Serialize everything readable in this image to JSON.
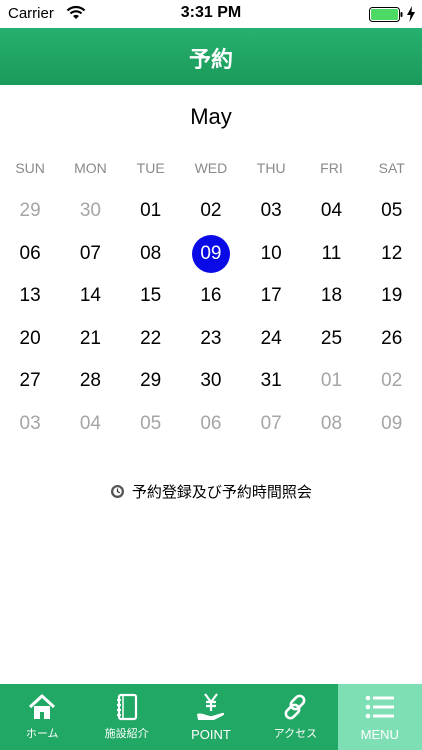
{
  "status_bar": {
    "carrier": "Carrier",
    "time": "3:31 PM"
  },
  "nav": {
    "title": "予約"
  },
  "calendar": {
    "month": "May",
    "weekdays": [
      "SUN",
      "MON",
      "TUE",
      "WED",
      "THU",
      "FRI",
      "SAT"
    ],
    "selected_day": "09",
    "days": [
      {
        "label": "29",
        "muted": true
      },
      {
        "label": "30",
        "muted": true
      },
      {
        "label": "01"
      },
      {
        "label": "02"
      },
      {
        "label": "03"
      },
      {
        "label": "04"
      },
      {
        "label": "05"
      },
      {
        "label": "06"
      },
      {
        "label": "07"
      },
      {
        "label": "08"
      },
      {
        "label": "09",
        "selected": true
      },
      {
        "label": "10"
      },
      {
        "label": "11"
      },
      {
        "label": "12"
      },
      {
        "label": "13"
      },
      {
        "label": "14"
      },
      {
        "label": "15"
      },
      {
        "label": "16"
      },
      {
        "label": "17"
      },
      {
        "label": "18"
      },
      {
        "label": "19"
      },
      {
        "label": "20"
      },
      {
        "label": "21"
      },
      {
        "label": "22"
      },
      {
        "label": "23"
      },
      {
        "label": "24"
      },
      {
        "label": "25"
      },
      {
        "label": "26"
      },
      {
        "label": "27"
      },
      {
        "label": "28"
      },
      {
        "label": "29"
      },
      {
        "label": "30"
      },
      {
        "label": "31"
      },
      {
        "label": "01",
        "muted": true
      },
      {
        "label": "02",
        "muted": true
      },
      {
        "label": "03",
        "muted": true
      },
      {
        "label": "04",
        "muted": true
      },
      {
        "label": "05",
        "muted": true
      },
      {
        "label": "06",
        "muted": true
      },
      {
        "label": "07",
        "muted": true
      },
      {
        "label": "08",
        "muted": true
      },
      {
        "label": "09",
        "muted": true
      }
    ]
  },
  "reserve_link": {
    "icon": "clock-icon",
    "label": "予約登録及び予約時間照会"
  },
  "tabs": [
    {
      "icon": "home-icon",
      "label": "ホーム"
    },
    {
      "icon": "notebook-icon",
      "label": "施設紹介"
    },
    {
      "icon": "yen-hand-icon",
      "label": "POINT"
    },
    {
      "icon": "link-icon",
      "label": "アクセス"
    },
    {
      "icon": "menu-icon",
      "label": "MENU",
      "active": true
    }
  ],
  "colors": {
    "header_green": "#22a865",
    "selected_blue": "#0a0ae6",
    "active_tab": "#7fdfb4",
    "muted_text": "#a5a5a5"
  }
}
